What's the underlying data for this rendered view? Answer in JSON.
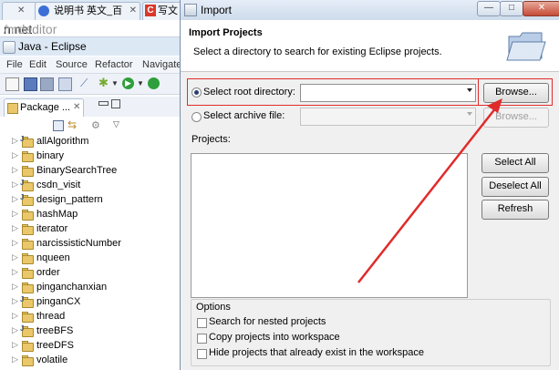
{
  "browser": {
    "tabs": [
      {
        "label": ""
      },
      {
        "label": "说明书 英文_百"
      },
      {
        "label": "写文"
      }
    ],
    "url": {
      "host": "n.net",
      "path": "/mdeditor"
    }
  },
  "eclipse": {
    "title": "Java - Eclipse",
    "menu": [
      "File",
      "Edit",
      "Source",
      "Refactor",
      "Navigate"
    ],
    "package_explorer": {
      "tab_label": "Package ...",
      "projects": [
        {
          "name": "allAlgorithm",
          "java": true
        },
        {
          "name": "binary",
          "java": false
        },
        {
          "name": "BinarySearchTree",
          "java": false
        },
        {
          "name": "csdn_visit",
          "java": true
        },
        {
          "name": "design_pattern",
          "java": true
        },
        {
          "name": "hashMap",
          "java": false
        },
        {
          "name": "iterator",
          "java": false
        },
        {
          "name": "narcissisticNumber",
          "java": false
        },
        {
          "name": "nqueen",
          "java": false
        },
        {
          "name": "order",
          "java": false
        },
        {
          "name": "pinganchanxian",
          "java": false
        },
        {
          "name": "pinganCX",
          "java": true
        },
        {
          "name": "thread",
          "java": false
        },
        {
          "name": "treeBFS",
          "java": true
        },
        {
          "name": "treeDFS",
          "java": false
        },
        {
          "name": "volatile",
          "java": false
        }
      ]
    }
  },
  "dialog": {
    "title": "Import",
    "controls": {
      "minimize": "—",
      "maximize": "□",
      "close": "✕"
    },
    "header_title": "Import Projects",
    "header_desc": "Select a directory to search for existing Eclipse projects.",
    "select_root_label": "Select root directory:",
    "select_root_value": "",
    "select_archive_label": "Select archive file:",
    "select_archive_value": "",
    "browse_root": "Browse...",
    "browse_archive": "Browse...",
    "projects_label": "Projects:",
    "select_all": "Select All",
    "deselect_all": "Deselect All",
    "refresh": "Refresh",
    "options_label": "Options",
    "options": [
      {
        "label": "Search for nested projects",
        "checked": false
      },
      {
        "label": "Copy projects into workspace",
        "checked": false
      },
      {
        "label": "Hide projects that already exist in the workspace",
        "checked": false
      }
    ],
    "root_selected": true
  },
  "annotation": {
    "color": "#e02b2b"
  }
}
